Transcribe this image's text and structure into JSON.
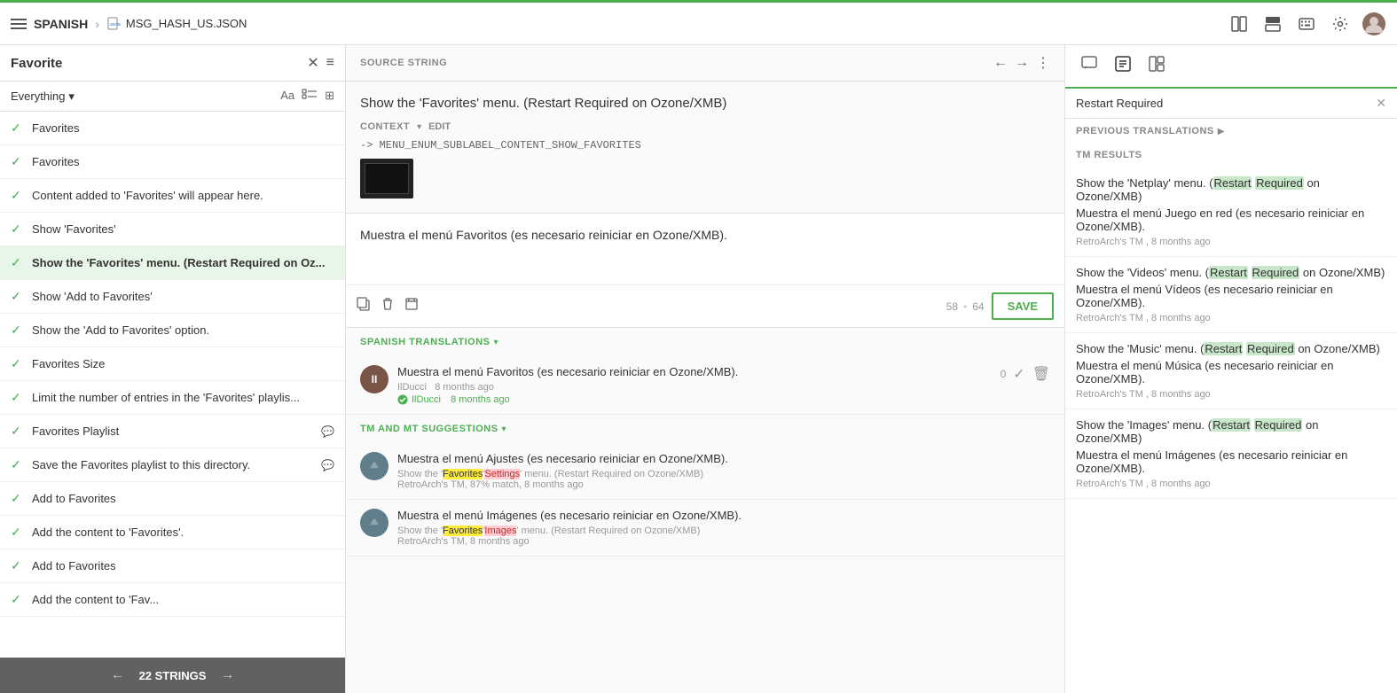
{
  "topbar": {
    "menu_label": "☰",
    "project_label": "SPANISH",
    "arrow": "›",
    "file_icon": "📄",
    "file_name": "MSG_HASH_US.JSON",
    "icons": [
      "layout1",
      "layout2",
      "keyboard",
      "settings",
      "avatar"
    ]
  },
  "left_panel": {
    "title": "Favorite",
    "close_icon": "✕",
    "filter_icon": "≡",
    "search": {
      "dropdown_label": "Everything",
      "dropdown_arrow": "▾"
    },
    "strings": [
      {
        "id": 1,
        "text": "Favorites",
        "checked": true
      },
      {
        "id": 2,
        "text": "Favorites",
        "checked": true
      },
      {
        "id": 3,
        "text": "Content added to 'Favorites' will appear here.",
        "checked": true
      },
      {
        "id": 4,
        "text": "Show 'Favorites'",
        "checked": true
      },
      {
        "id": 5,
        "text": "Show the 'Favorites' menu. (Restart Required on Oz...",
        "checked": true,
        "active": true
      },
      {
        "id": 6,
        "text": "Show 'Add to Favorites'",
        "checked": true
      },
      {
        "id": 7,
        "text": "Show the 'Add to Favorites' option.",
        "checked": true
      },
      {
        "id": 8,
        "text": "Favorites Size",
        "checked": true
      },
      {
        "id": 9,
        "text": "Limit the number of entries in the 'Favorites' playlis...",
        "checked": true
      },
      {
        "id": 10,
        "text": "Favorites Playlist",
        "checked": true,
        "has_comment": true
      },
      {
        "id": 11,
        "text": "Save the Favorites playlist to this directory.",
        "checked": true,
        "has_comment": true
      },
      {
        "id": 12,
        "text": "Add to Favorites",
        "checked": true
      },
      {
        "id": 13,
        "text": "Add the content to 'Favorites'.",
        "checked": true
      },
      {
        "id": 14,
        "text": "Add to Favorites",
        "checked": true
      },
      {
        "id": 15,
        "text": "Add the content to 'Fav...",
        "checked": true
      }
    ],
    "footer": {
      "label": "22 STRINGS",
      "prev_arrow": "←",
      "next_arrow": "→"
    }
  },
  "source_string": {
    "header_label": "SOURCE STRING",
    "text": "Show the 'Favorites' menu. (Restart Required on Ozone/XMB)",
    "context_label": "CONTEXT",
    "edit_label": "EDIT",
    "context_value": "-> MENU_ENUM_SUBLABEL_CONTENT_SHOW_FAVORITES",
    "translation_text": "Muestra el menú Favoritos (es necesario reiniciar en Ozone/XMB).",
    "char_count": "58",
    "char_limit": "64",
    "save_label": "SAVE"
  },
  "spanish_translations": {
    "header_label": "SPANISH TRANSLATIONS",
    "entry": {
      "user_initials": "II",
      "text": "Muestra el menú Favoritos (es necesario reiniciar en Ozone/XMB).",
      "user": "IlDucci",
      "time_ago": "8 months ago",
      "verified_by": "IlDucci",
      "verified_time": "8 months ago",
      "vote_count": "0"
    }
  },
  "tm_suggestions": {
    "header_label": "TM AND MT SUGGESTIONS",
    "entries": [
      {
        "text": "Muestra el menú Ajustes (es necesario reiniciar en Ozone/XMB).",
        "source_text": "Show the 'Favorites''Settings' menu. (Restart Required on Ozone/XMB)",
        "meta": "RetroArch's TM, 87% match, 8 months ago"
      },
      {
        "text": "Muestra el menú Imágenes (es necesario reiniciar en Ozone/XMB).",
        "source_text": "Show the 'Favorites''Images' menu. (Restart Required on Ozone/XMB)",
        "meta": "RetroArch's TM, 8 months ago"
      }
    ]
  },
  "right_panel": {
    "search_value": "Restart Required",
    "prev_translations_label": "PREVIOUS TRANSLATIONS",
    "tm_results_label": "TM RESULTS",
    "results": [
      {
        "source": "Show the 'Netplay' menu. (Restart Required on Ozone/XMB)",
        "target": "Muestra el menú Juego en red (es necesario reiniciar en Ozone/XMB).",
        "meta": "RetroArch's TM , 8 months ago"
      },
      {
        "source": "Show the 'Videos' menu. (Restart Required on Ozone/XMB)",
        "target": "Muestra el menú Vídeos (es necesario reiniciar en Ozone/XMB).",
        "meta": "RetroArch's TM , 8 months ago"
      },
      {
        "source": "Show the 'Music' menu. (Restart Required on Ozone/XMB)",
        "target": "Muestra el menú Música (es necesario reiniciar en Ozone/XMB).",
        "meta": "RetroArch's TM , 8 months ago"
      },
      {
        "source": "Show the 'Images' menu. (Restart Required on Ozone/XMB)",
        "target": "Muestra el menú Imágenes (es necesario reiniciar en Ozone/XMB).",
        "meta": "RetroArch's TM , 8 months ago"
      }
    ]
  },
  "colors": {
    "green": "#4caf50",
    "red": "#e53935",
    "yellow_highlight": "#ffeb3b",
    "green_highlight": "#c8e6c9",
    "red_highlight": "#ffcdd2"
  }
}
